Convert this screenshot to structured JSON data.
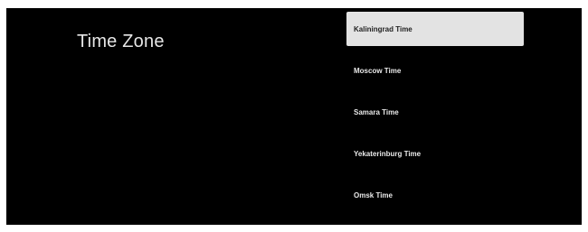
{
  "page": {
    "title": "Time Zone"
  },
  "time_zones": {
    "selected_index": 0,
    "items": [
      {
        "label": "Kaliningrad Time"
      },
      {
        "label": "Moscow Time"
      },
      {
        "label": "Samara Time"
      },
      {
        "label": "Yekaterinburg Time"
      },
      {
        "label": "Omsk Time"
      }
    ]
  },
  "colors": {
    "background": "#000000",
    "text": "#e9e9e9",
    "selected_background": "#e3e3e3",
    "selected_text": "#222222"
  }
}
